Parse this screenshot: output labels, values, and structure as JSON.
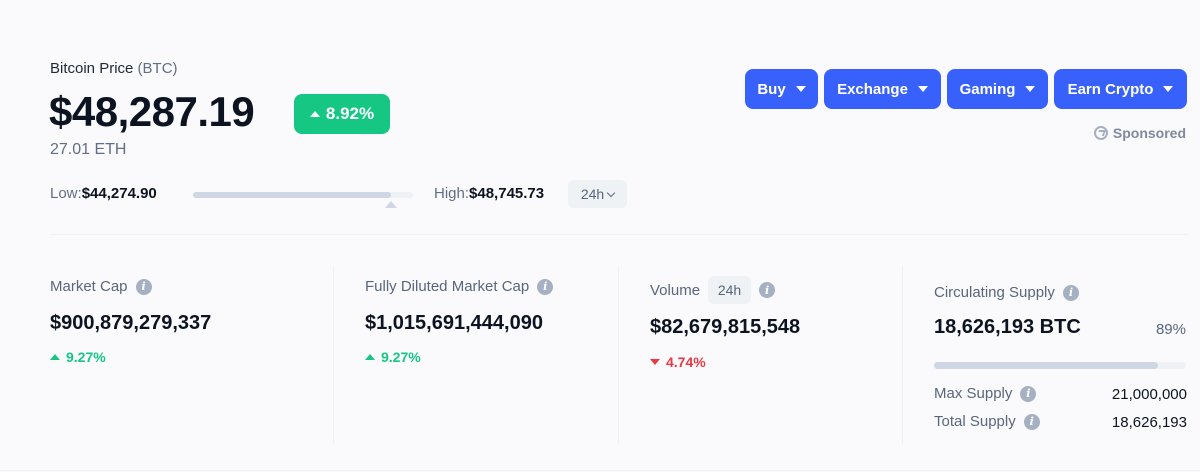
{
  "header": {
    "title": "Bitcoin Price",
    "symbol": "(BTC)",
    "price": "$48,287.19",
    "change_pct": "8.92%",
    "eth_price": "27.01 ETH"
  },
  "range": {
    "low_label": "Low:",
    "low_value": "$44,274.90",
    "high_label": "High:",
    "high_value": "$48,745.73",
    "period": "24h",
    "position": 0.9
  },
  "actions": {
    "buy": "Buy",
    "exchange": "Exchange",
    "gaming": "Gaming",
    "earn": "Earn Crypto",
    "sponsored": "Sponsored"
  },
  "stats": {
    "market_cap": {
      "label": "Market Cap",
      "value": "$900,879,279,337",
      "change": "9.27%",
      "direction": "up"
    },
    "fdmc": {
      "label": "Fully Diluted Market Cap",
      "value": "$1,015,691,444,090",
      "change": "9.27%",
      "direction": "up"
    },
    "volume": {
      "label": "Volume",
      "period": "24h",
      "value": "$82,679,815,548",
      "change": "4.74%",
      "direction": "down"
    },
    "supply": {
      "label": "Circulating Supply",
      "value": "18,626,193 BTC",
      "percent": "89%",
      "fill": 0.89,
      "max_label": "Max Supply",
      "max_value": "21,000,000",
      "total_label": "Total Supply",
      "total_value": "18,626,193"
    }
  },
  "colors": {
    "accent": "#3861fb",
    "positive": "#16c784",
    "negative": "#ea3943"
  }
}
